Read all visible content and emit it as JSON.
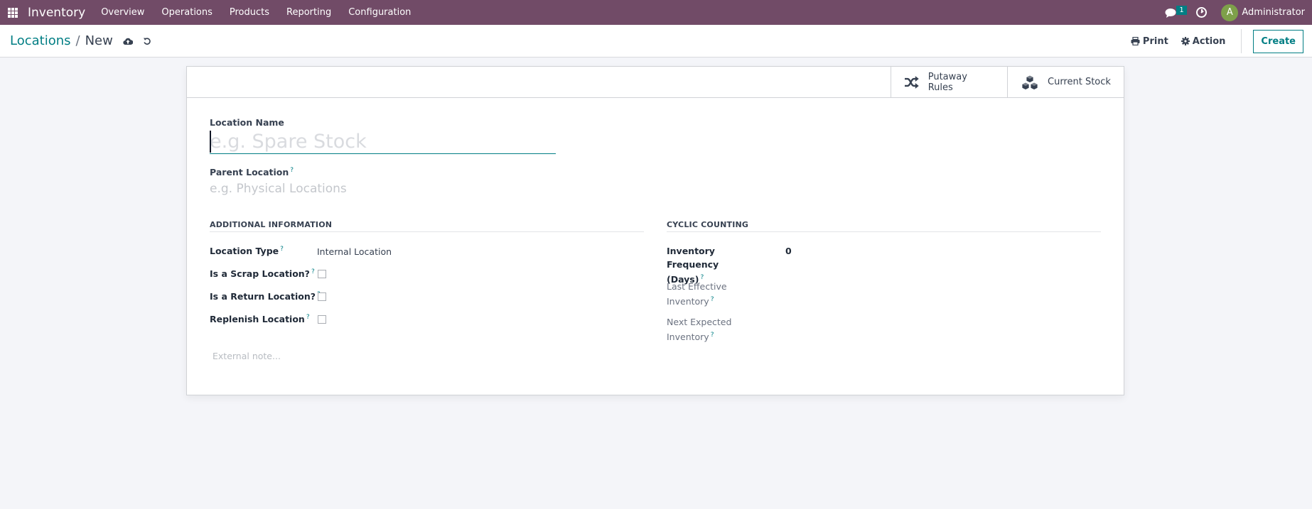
{
  "navbar": {
    "app_name": "Inventory",
    "menu": [
      "Overview",
      "Operations",
      "Products",
      "Reporting",
      "Configuration"
    ],
    "chat_badge": "1",
    "user_initial": "A",
    "user_name": "Administrator",
    "color": "#714b67"
  },
  "control_panel": {
    "breadcrumb_parent": "Locations",
    "breadcrumb_separator": "/",
    "breadcrumb_current": "New",
    "print_label": "Print",
    "action_label": "Action",
    "create_label": "Create",
    "accent_color": "#017e84"
  },
  "smart_buttons": {
    "putaway": "Putaway Rules",
    "stock": "Current Stock"
  },
  "form": {
    "name_label": "Location Name",
    "name_value": "",
    "name_placeholder": "e.g. Spare Stock",
    "parent_label": "Parent Location",
    "parent_value": "",
    "parent_placeholder": "e.g. Physical Locations",
    "help_mark": "?",
    "additional": {
      "title": "ADDITIONAL INFORMATION",
      "location_type_label": "Location Type",
      "location_type_value": "Internal Location",
      "scrap_label": "Is a Scrap Location?",
      "scrap_checked": false,
      "return_label": "Is a Return Location?",
      "return_checked": false,
      "replenish_label": "Replenish Location",
      "replenish_checked": false
    },
    "cyclic": {
      "title": "CYCLIC COUNTING",
      "frequency_label_1": "Inventory Frequency",
      "frequency_label_2": "(Days)",
      "frequency_value": "0",
      "last_label_1": "Last Effective",
      "last_label_2": "Inventory",
      "next_label_1": "Next Expected",
      "next_label_2": "Inventory"
    },
    "note_placeholder": "External note..."
  }
}
